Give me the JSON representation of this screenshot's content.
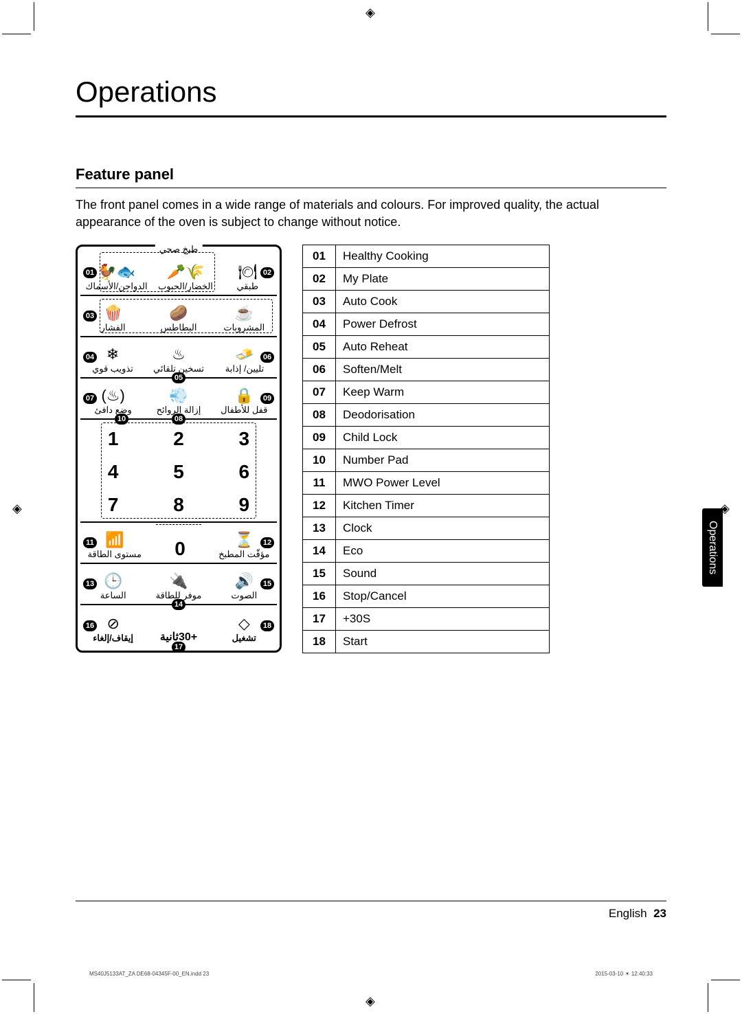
{
  "title": "Operations",
  "subtitle": "Feature panel",
  "intro": "The front panel comes in a wide range of materials and colours. For improved quality, the actual appearance of the oven is subject to change without notice.",
  "side_tab": "Operations",
  "footer_lang": "English",
  "footer_page": "23",
  "print_info_left": "MS40J5133AT_ZA DE68-04345F-00_EN.indd   23",
  "print_info_right": "2015-03-10   ☀ 12:40:33",
  "panel": {
    "row1_top": "طبخ صحي",
    "row1": {
      "c01": "01",
      "lbl1": "الدواجن/الأسماك",
      "lbl2": "الخضار/الحبوب",
      "c02": "02",
      "lbl3": "طبقي"
    },
    "row2": {
      "c03": "03",
      "lbl1": "الفشار",
      "lbl2": "البطاطس",
      "lbl3": "المشروبات"
    },
    "row3": {
      "c04": "04",
      "lbl1": "تذويب قوي",
      "c05": "05",
      "lbl2": "تسخين تلقائي",
      "c06": "06",
      "lbl3": "تليين/ إذابة"
    },
    "row4": {
      "c07": "07",
      "lbl1": "وضع دافئ",
      "c08": "08",
      "lbl2": "إزالة الروائح",
      "c09": "09",
      "lbl3": "قفل للأطفال"
    },
    "row5": {
      "c10": "10",
      "n1": "1",
      "n2": "2",
      "n3": "3",
      "n4": "4",
      "n5": "5",
      "n6": "6",
      "n7": "7",
      "n8": "8",
      "n9": "9"
    },
    "row6": {
      "c11": "11",
      "lbl1": "مستوى الطاقة",
      "n0": "0",
      "c12": "12",
      "lbl3": "مؤقّت المطبخ"
    },
    "row7": {
      "c13": "13",
      "lbl1": "الساعة",
      "c14": "14",
      "lbl2": "موفر للطاقة",
      "c15": "15",
      "lbl3": "الصوت"
    },
    "row8": {
      "c16": "16",
      "lbl1": "إيقاف/إلغاء",
      "c17": "17",
      "lbl2": "+30ثانية",
      "c18": "18",
      "lbl3": "تشغيل"
    }
  },
  "features": [
    {
      "num": "01",
      "label": "Healthy Cooking"
    },
    {
      "num": "02",
      "label": "My Plate"
    },
    {
      "num": "03",
      "label": "Auto Cook"
    },
    {
      "num": "04",
      "label": "Power Defrost"
    },
    {
      "num": "05",
      "label": "Auto Reheat"
    },
    {
      "num": "06",
      "label": "Soften/Melt"
    },
    {
      "num": "07",
      "label": "Keep Warm"
    },
    {
      "num": "08",
      "label": "Deodorisation"
    },
    {
      "num": "09",
      "label": "Child Lock"
    },
    {
      "num": "10",
      "label": "Number Pad"
    },
    {
      "num": "11",
      "label": "MWO Power Level"
    },
    {
      "num": "12",
      "label": "Kitchen Timer"
    },
    {
      "num": "13",
      "label": "Clock"
    },
    {
      "num": "14",
      "label": "Eco"
    },
    {
      "num": "15",
      "label": "Sound"
    },
    {
      "num": "16",
      "label": "Stop/Cancel"
    },
    {
      "num": "17",
      "label": "+30S"
    },
    {
      "num": "18",
      "label": "Start"
    }
  ]
}
